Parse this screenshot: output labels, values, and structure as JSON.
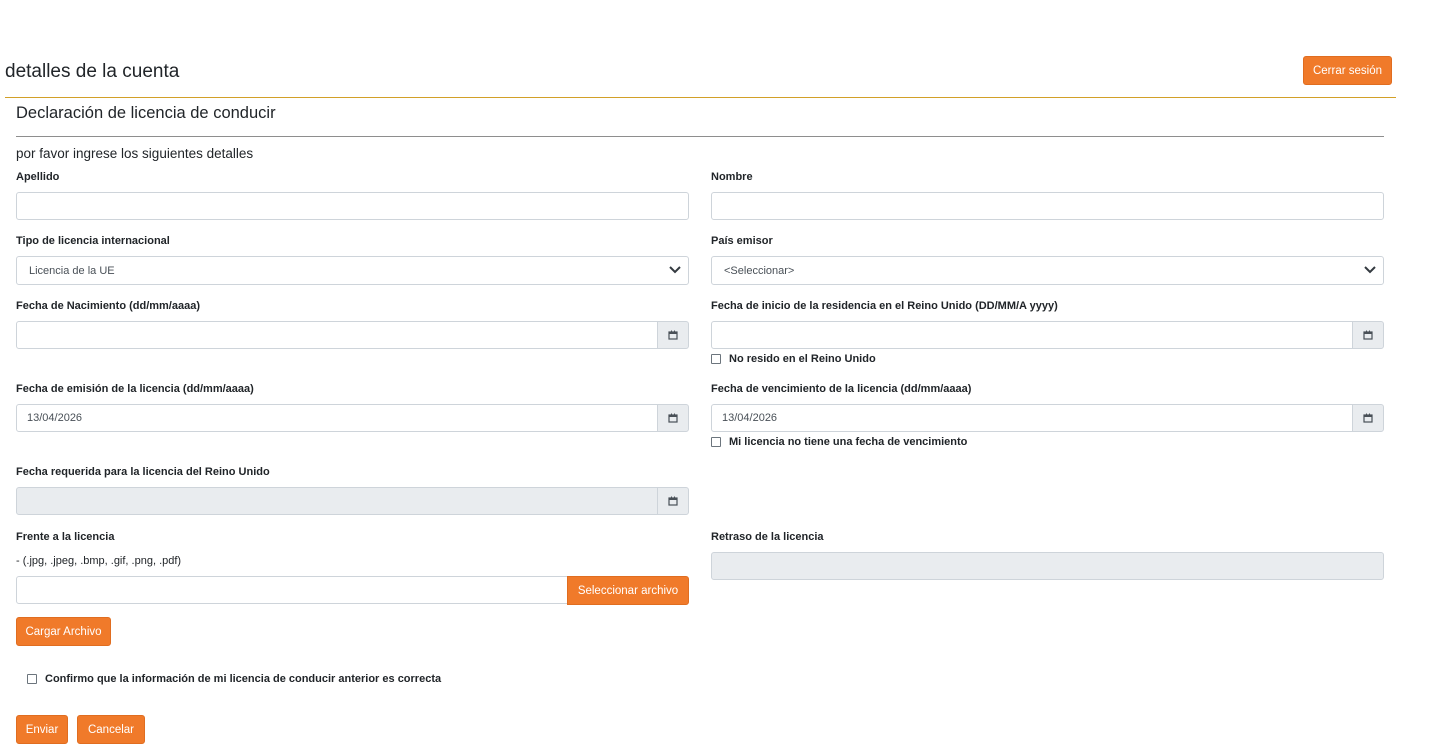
{
  "header": {
    "title": "detalles de la cuenta",
    "logout_label": "Cerrar sesión"
  },
  "section": {
    "title": "Declaración de licencia de conducir",
    "intro": "por favor ingrese los siguientes detalles"
  },
  "fields": {
    "surname": {
      "label": "Apellido",
      "value": ""
    },
    "first_name": {
      "label": "Nombre",
      "value": ""
    },
    "license_type": {
      "label": "Tipo de licencia internacional",
      "selected": "Licencia de la UE"
    },
    "issuing_country": {
      "label": "País emisor",
      "selected": "<Seleccionar>"
    },
    "birth_date": {
      "label": "Fecha de Nacimiento (dd/mm/aaaa)",
      "value": ""
    },
    "uk_residence_start": {
      "label": "Fecha de inicio de la residencia en el Reino Unido (DD/MM/A yyyy)",
      "value": ""
    },
    "not_uk_resident": {
      "label": "No resido en el Reino Unido",
      "checked": false
    },
    "issue_date": {
      "label": "Fecha de emisión de la licencia (dd/mm/aaaa)",
      "value": "13/04/2026"
    },
    "expiry_date": {
      "label": "Fecha de vencimiento de la licencia (dd/mm/aaaa)",
      "value": "13/04/2026"
    },
    "no_expiry": {
      "label": "Mi licencia no tiene una fecha de vencimiento",
      "checked": false
    },
    "uk_required_date": {
      "label": "Fecha requerida para la licencia del Reino Unido",
      "value": ""
    },
    "license_front": {
      "label": "Frente a la licencia",
      "hint": "- (.jpg, .jpeg, .bmp, .gif, .png, .pdf)",
      "value": "",
      "browse_label": "Seleccionar archivo",
      "upload_label": "Cargar Archivo"
    },
    "license_back": {
      "label": "Retraso de la licencia",
      "value": ""
    }
  },
  "confirm": {
    "label": "Confirmo que la información de mi licencia de conducir anterior es correcta",
    "checked": false
  },
  "actions": {
    "submit_label": "Enviar",
    "cancel_label": "Cancelar"
  },
  "colors": {
    "accent": "#f07a2a",
    "rule": "#d2a028",
    "disabled_bg": "#e9ecef"
  },
  "icons": {
    "select_arrow": "chevron-down-icon",
    "date_picker": "calendar-icon"
  }
}
